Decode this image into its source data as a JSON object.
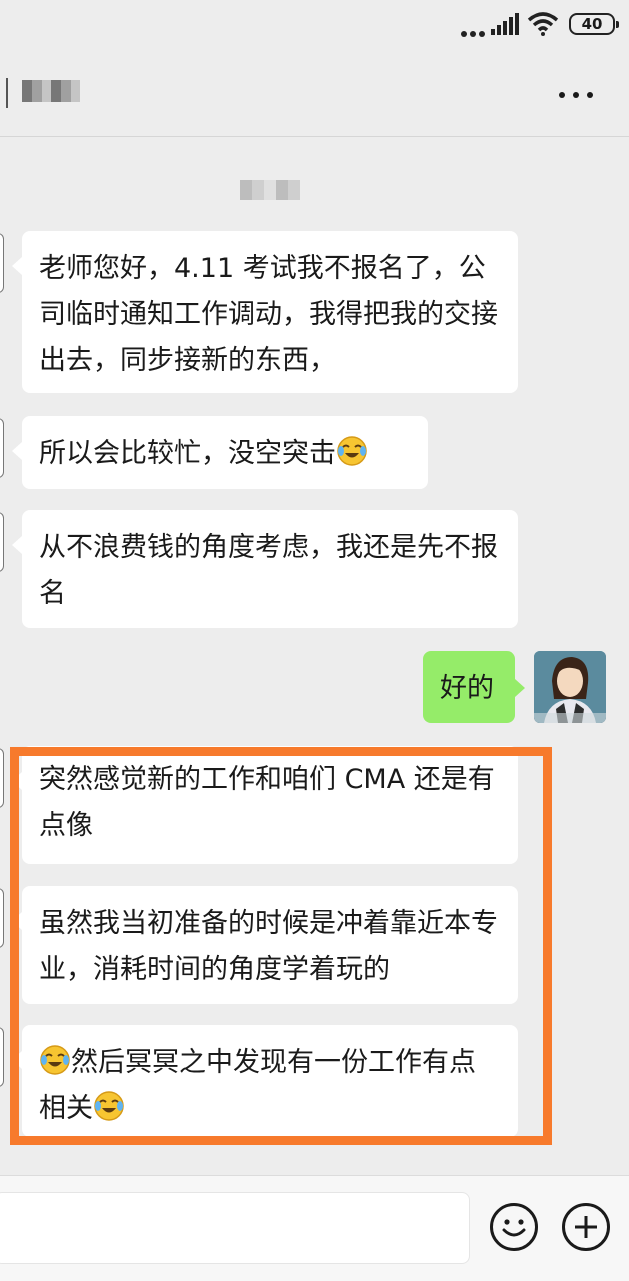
{
  "status_bar": {
    "battery": "40"
  },
  "header": {
    "more_icon": "more-horizontal-icon"
  },
  "messages": [
    {
      "side": "left",
      "text": "老师您好，4.11 考试我不报名了，公司临时通知工作调动，我得把我的交接出去，同步接新的东西，"
    },
    {
      "side": "left",
      "text": "所以会比较忙，没空突击",
      "trailing_emoji": "crying-laughing-emoji"
    },
    {
      "side": "left",
      "text": "从不浪费钱的角度考虑，我还是先不报名"
    },
    {
      "side": "right",
      "text": "好的"
    },
    {
      "side": "left",
      "text": "突然感觉新的工作和咱们 CMA 还是有点像"
    },
    {
      "side": "left",
      "text": "虽然我当初准备的时候是冲着靠近本专业，消耗时间的角度学着玩的"
    },
    {
      "side": "left",
      "leading_emoji": "crying-laughing-emoji",
      "text": "然后冥冥之中发现有一份工作有点相关",
      "trailing_emoji": "crying-laughing-emoji"
    }
  ],
  "highlight_color": "#f77a2c",
  "bubble_colors": {
    "incoming": "#ffffff",
    "outgoing": "#95ec69"
  },
  "input_bar": {
    "emoji_icon": "smiley-face-icon",
    "add_icon": "plus-circle-icon"
  }
}
